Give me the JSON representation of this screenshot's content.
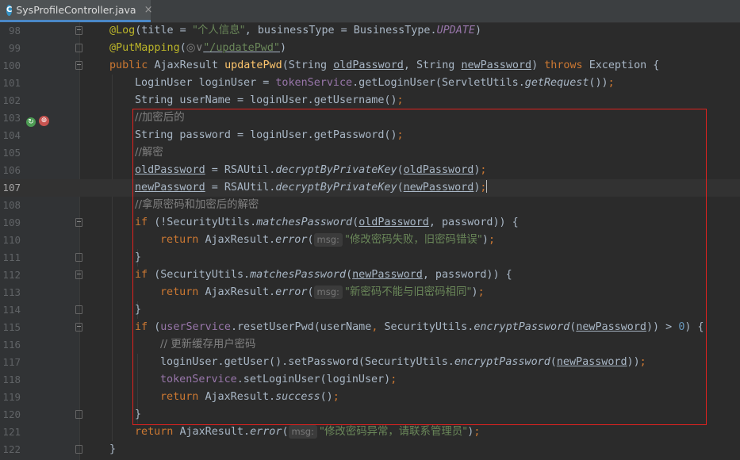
{
  "tab": {
    "icon": "C",
    "title": "SysProfileController.java",
    "close": "×"
  },
  "gutter_icons": {
    "run": "↻",
    "override": "⊕"
  },
  "lines": {
    "l98": {
      "num": "98",
      "a1": "@Log",
      "a2": "(title = ",
      "a3": "\"个人信息\"",
      "a4": ", businessType = BusinessType.",
      "a5": "UPDATE",
      "a6": ")"
    },
    "l99": {
      "num": "99",
      "a1": "@PutMapping",
      "a2": "(",
      "a3": "◎∨",
      "a4": "\"/updatePwd\"",
      "a5": ")"
    },
    "l100": {
      "num": "100",
      "a1": "public ",
      "a2": "AjaxResult ",
      "a3": "updatePwd",
      "a4": "(String ",
      "a5": "oldPassword",
      "a6": ", String ",
      "a7": "newPassword",
      "a8": ") ",
      "a9": "throws ",
      "a10": "Exception {"
    },
    "l101": {
      "num": "101",
      "a1": "LoginUser loginUser = ",
      "a2": "tokenService",
      "a3": ".getLoginUser(ServletUtils.",
      "a4": "getRequest",
      "a5": "())",
      "a6": ";"
    },
    "l102": {
      "num": "102",
      "a1": "String userName = loginUser.getUsername()",
      "a2": ";"
    },
    "l103": {
      "num": "103",
      "a1": "//加密后的"
    },
    "l104": {
      "num": "104",
      "a1": "String password = loginUser.getPassword()",
      "a2": ";"
    },
    "l105": {
      "num": "105",
      "a1": "//解密"
    },
    "l106": {
      "num": "106",
      "a1": "oldPassword",
      "a2": " = RSAUtil.",
      "a3": "decryptByPrivateKey",
      "a4": "(",
      "a5": "oldPassword",
      "a6": ")",
      "a7": ";"
    },
    "l107": {
      "num": "107",
      "a1": "newPassword",
      "a2": " = RSAUtil.",
      "a3": "decryptByPrivateKey",
      "a4": "(",
      "a5": "newPassword",
      "a6": ")",
      "a7": ";"
    },
    "l108": {
      "num": "108",
      "a1": "//拿原密码和加密后的解密"
    },
    "l109": {
      "num": "109",
      "a1": "if ",
      "a2": "(!SecurityUtils.",
      "a3": "matchesPassword",
      "a4": "(",
      "a5": "oldPassword",
      "a6": ", password)) {"
    },
    "l110": {
      "num": "110",
      "a1": "return ",
      "a2": "AjaxResult.",
      "a3": "error",
      "a4": "(",
      "a5": "msg:",
      "a6": "\"修改密码失败，旧密码错误\"",
      "a7": ")",
      "a8": ";"
    },
    "l111": {
      "num": "111",
      "a1": "}"
    },
    "l112": {
      "num": "112",
      "a1": "if ",
      "a2": "(SecurityUtils.",
      "a3": "matchesPassword",
      "a4": "(",
      "a5": "newPassword",
      "a6": ", password)) {"
    },
    "l113": {
      "num": "113",
      "a1": "return ",
      "a2": "AjaxResult.",
      "a3": "error",
      "a4": "(",
      "a5": "msg:",
      "a6": "\"新密码不能与旧密码相同\"",
      "a7": ")",
      "a8": ";"
    },
    "l114": {
      "num": "114",
      "a1": "}"
    },
    "l115": {
      "num": "115",
      "a1": "if ",
      "a2": "(",
      "a3": "userService",
      "a4": ".resetUserPwd(userName",
      "a5": ", ",
      "a6": "SecurityUtils.",
      "a7": "encryptPassword",
      "a8": "(",
      "a9": "newPassword",
      "a10": ")) > ",
      "a11": "0",
      "a12": ") {"
    },
    "l116": {
      "num": "116",
      "a1": "// 更新缓存用户密码"
    },
    "l117": {
      "num": "117",
      "a1": "loginUser.getUser().setPassword(SecurityUtils.",
      "a2": "encryptPassword",
      "a3": "(",
      "a4": "newPassword",
      "a5": "))",
      "a6": ";"
    },
    "l118": {
      "num": "118",
      "a1": "tokenService",
      "a2": ".setLoginUser(loginUser)",
      "a3": ";"
    },
    "l119": {
      "num": "119",
      "a1": "return ",
      "a2": "AjaxResult.",
      "a3": "success",
      "a4": "()",
      "a5": ";"
    },
    "l120": {
      "num": "120",
      "a1": "}"
    },
    "l121": {
      "num": "121",
      "a1": "return ",
      "a2": "AjaxResult.",
      "a3": "error",
      "a4": "(",
      "a5": "msg:",
      "a6": "\"修改密码异常，请联系管理员\"",
      "a7": ")",
      "a8": ";"
    },
    "l122": {
      "num": "122",
      "a1": "}"
    }
  },
  "colors": {
    "keyword": "#cc7832",
    "annotation": "#bbb529",
    "string": "#6a8759",
    "method": "#ffc66d",
    "field": "#9876aa",
    "highlight_box": "#e0221f"
  }
}
